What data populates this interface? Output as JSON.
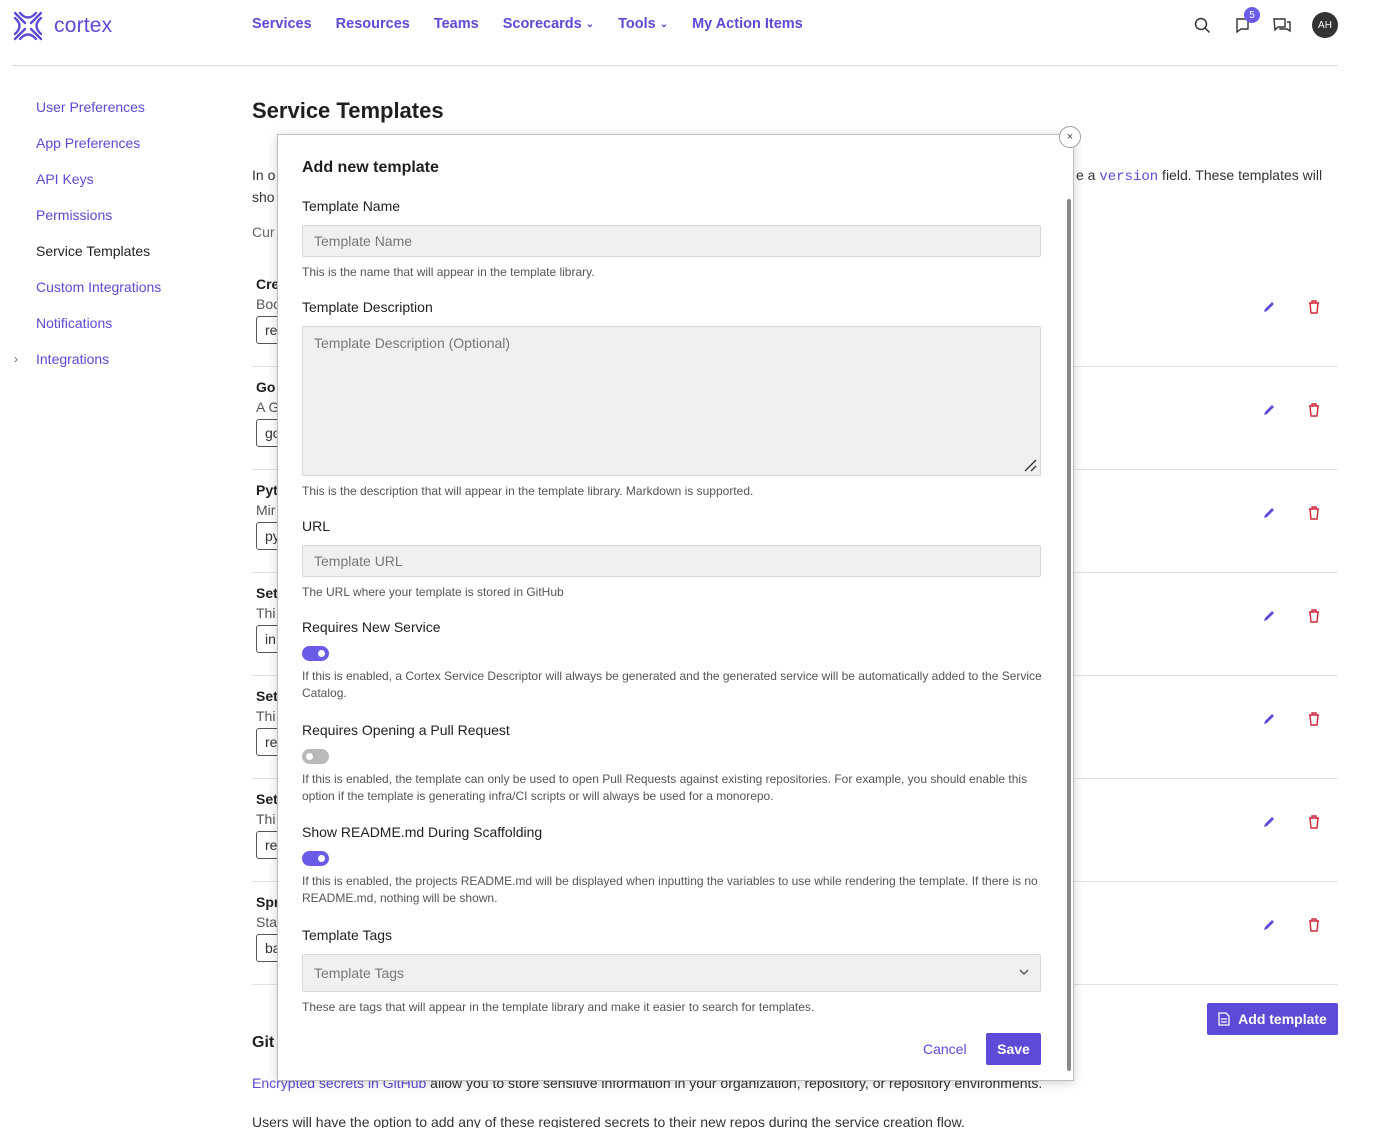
{
  "brand": {
    "name": "cortex",
    "color": "#5b4bd6"
  },
  "nav": {
    "items": [
      {
        "label": "Services"
      },
      {
        "label": "Resources"
      },
      {
        "label": "Teams"
      },
      {
        "label": "Scorecards",
        "dropdown": true
      },
      {
        "label": "Tools",
        "dropdown": true
      },
      {
        "label": "My Action Items"
      }
    ],
    "notifications_count": "5",
    "avatar_initials": "AH"
  },
  "sidebar": {
    "items": [
      {
        "label": "User Preferences"
      },
      {
        "label": "App Preferences"
      },
      {
        "label": "API Keys"
      },
      {
        "label": "Permissions"
      },
      {
        "label": "Service Templates",
        "active": true
      },
      {
        "label": "Custom Integrations"
      },
      {
        "label": "Notifications"
      },
      {
        "label": "Integrations",
        "expandable": true
      }
    ]
  },
  "main": {
    "title": "Service Templates",
    "intro_start": "In o",
    "intro_start2": "sho",
    "intro_end_pre": "e a ",
    "intro_code": "version",
    "intro_end_post": " field. These templates will",
    "cur_text": "Cur",
    "rows": [
      {
        "title": "Cre",
        "desc": "Boo",
        "chip": "re"
      },
      {
        "title": "Go ",
        "desc": "A G",
        "chip": "go"
      },
      {
        "title": "Pyt",
        "desc": "Mir",
        "chip": "py"
      },
      {
        "title": "Set",
        "desc": "Thi",
        "chip": "in"
      },
      {
        "title": "Set",
        "desc": "Thi",
        "chip": "re"
      },
      {
        "title": "Set",
        "desc": "Thi",
        "chip": "re"
      },
      {
        "title": "Spr",
        "desc": "Sta",
        "chip": "ba"
      }
    ],
    "add_button": "Add template",
    "github_title": "Git",
    "github_link": "Encrypted secrets in GitHub",
    "github_text": " allow you to store sensitive information in your organization, repository, or repository environments.",
    "github_text2": "Users will have the option to add any of these registered secrets to their new repos during the service creation flow."
  },
  "modal": {
    "title": "Add new template",
    "close": "×",
    "name_label": "Template Name",
    "name_placeholder": "Template Name",
    "name_help": "This is the name that will appear in the template library.",
    "desc_label": "Template Description",
    "desc_placeholder": "Template Description (Optional)",
    "desc_help": "This is the description that will appear in the template library. Markdown is supported.",
    "url_label": "URL",
    "url_placeholder": "Template URL",
    "url_help": "The URL where your template is stored in GitHub",
    "requires_new_service_label": "Requires New Service",
    "requires_new_service_on": true,
    "requires_new_service_help": "If this is enabled, a Cortex Service Descriptor will always be generated and the generated service will be automatically added to the Service Catalog.",
    "requires_pr_label": "Requires Opening a Pull Request",
    "requires_pr_on": false,
    "requires_pr_help": "If this is enabled, the template can only be used to open Pull Requests against existing repositories. For example, you should enable this option if the template is generating infra/CI scripts or will always be used for a monorepo.",
    "show_readme_label": "Show README.md During Scaffolding",
    "show_readme_on": true,
    "show_readme_help": "If this is enabled, the projects README.md will be displayed when inputting the variables to use while rendering the template. If there is no README.md, nothing will be shown.",
    "tags_label": "Template Tags",
    "tags_placeholder": "Template Tags",
    "tags_help": "These are tags that will appear in the template library and make it easier to search for templates.",
    "cancel_label": "Cancel",
    "save_label": "Save"
  }
}
